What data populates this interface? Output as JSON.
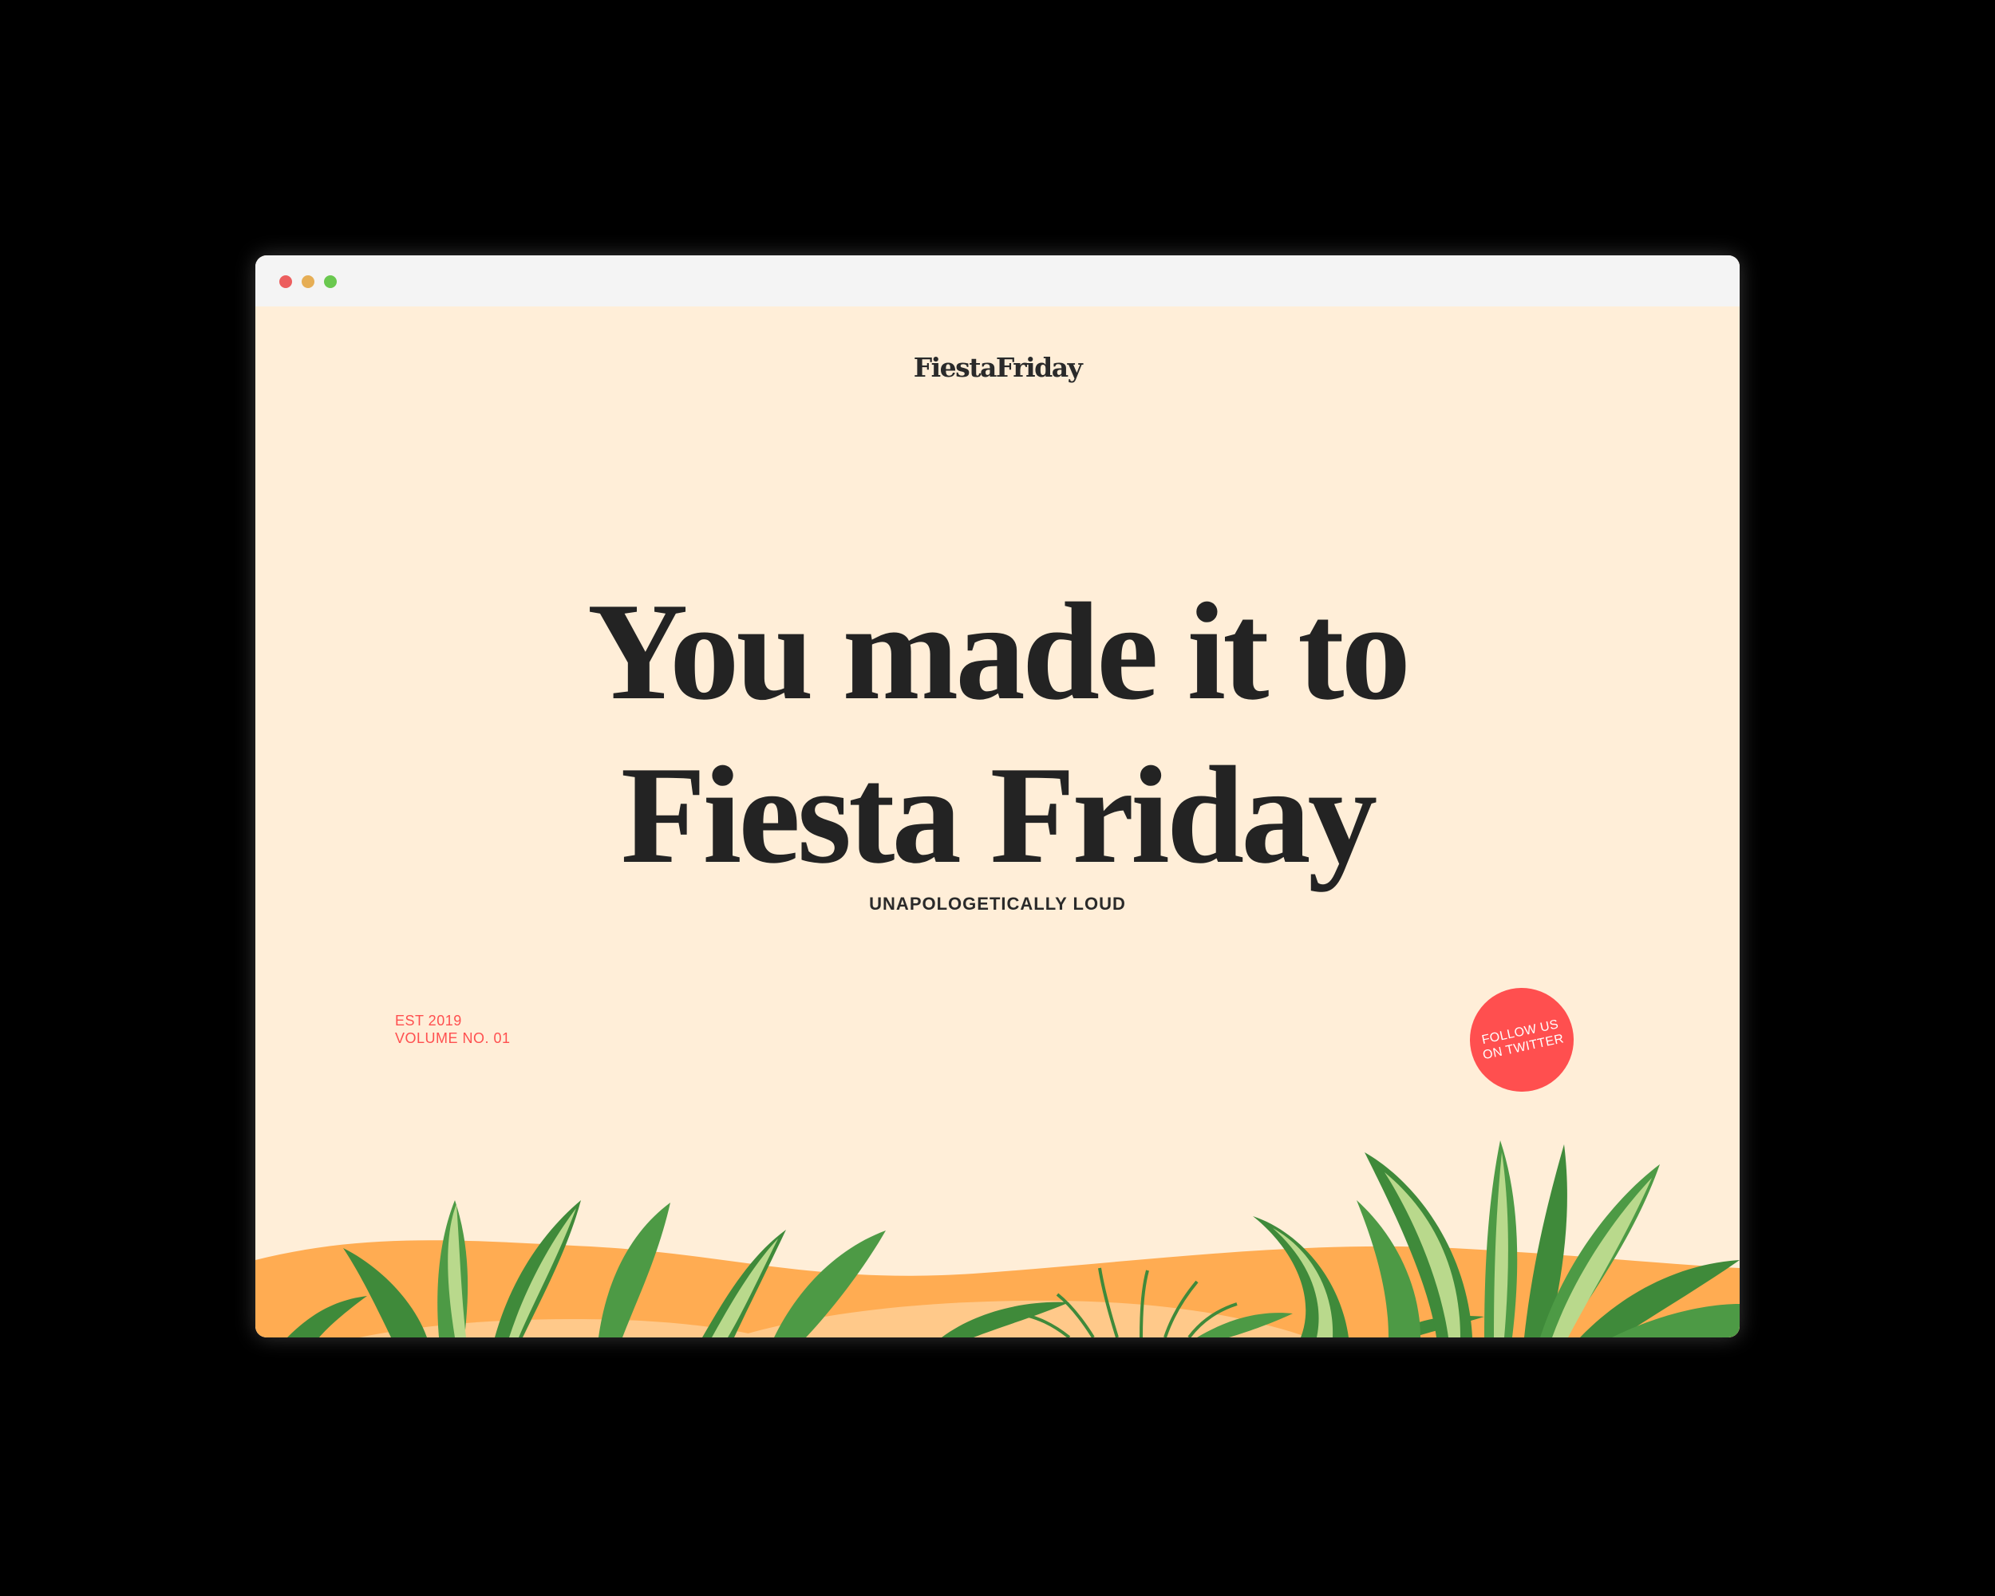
{
  "colors": {
    "outer_background": "#000000",
    "titlebar": "#f4f4f4",
    "page_background": "#ffeed8",
    "text_dark": "#232323",
    "accent_red": "#ff4f4f",
    "dot_red": "#ec5e5e",
    "dot_yellow": "#e6ae55",
    "dot_green": "#6ac84f",
    "wave_orange": "#ffac52",
    "wave_light": "#ffc98a",
    "leaf_green": "#3f8a3a",
    "leaf_light": "#b9d98c"
  },
  "window": {
    "controls": [
      {
        "name": "close",
        "color": "#ec5e5e"
      },
      {
        "name": "minimize",
        "color": "#e6ae55"
      },
      {
        "name": "maximize",
        "color": "#6ac84f"
      }
    ]
  },
  "header": {
    "logo_text": "FiestaFriday"
  },
  "hero": {
    "headline_line1": "You made it to",
    "headline_line2": "Fiesta Friday",
    "tagline": "UNAPOLOGETICALLY LOUD"
  },
  "meta": {
    "est": "EST 2019",
    "volume": "VOLUME NO. 01"
  },
  "follow": {
    "line1": "FOLLOW US",
    "line2": "ON TWITTER"
  },
  "decoration": {
    "left_plant": "tropical-plant-illustration",
    "center_plant": "fern-plant-illustration",
    "right_plant": "tropical-plant-illustration"
  }
}
